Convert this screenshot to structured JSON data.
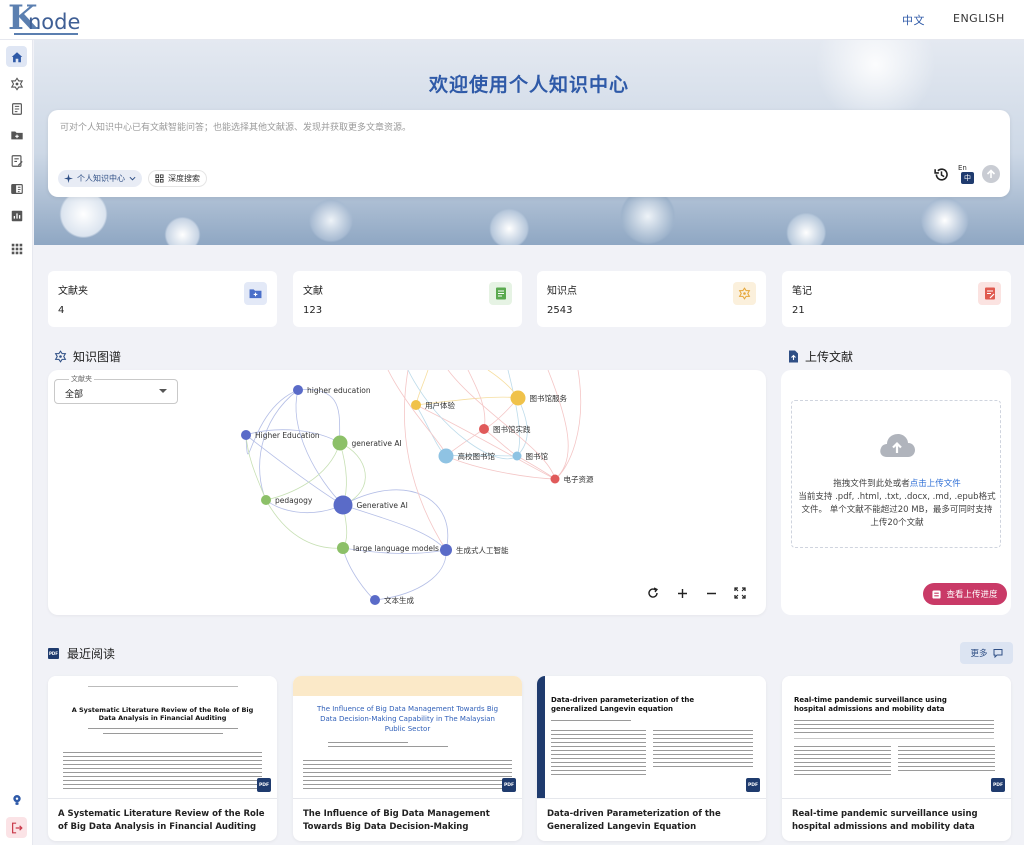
{
  "app": {
    "logo_k": "K",
    "logo_rest": "node"
  },
  "topbar": {
    "lang_zh": "中文",
    "lang_en": "ENGLISH"
  },
  "sidebar": {
    "items": [
      "home-icon",
      "knowledge-graph-icon",
      "library-icon",
      "folder-add-icon",
      "notes-icon",
      "reading-icon",
      "stats-icon",
      "apps-icon"
    ],
    "bottom": [
      "help-icon",
      "logout-icon"
    ]
  },
  "hero": {
    "title": "欢迎使用个人知识中心",
    "search_placeholder": "可对个人知识中心已有文献智能问答；也能选择其他文献源、发现并获取更多文章资源。",
    "chip_source": "个人知识中心",
    "chip_deep": "深度搜索",
    "lang_en": "En",
    "lang_zh": "中"
  },
  "stats": [
    {
      "label": "文献夹",
      "value": "4",
      "icon": "folder-icon",
      "color": "#4a6fc9"
    },
    {
      "label": "文献",
      "value": "123",
      "icon": "document-icon",
      "color": "#5aaa4f"
    },
    {
      "label": "知识点",
      "value": "2543",
      "icon": "knowledge-point-icon",
      "color": "#e6a73a"
    },
    {
      "label": "笔记",
      "value": "21",
      "icon": "note-icon",
      "color": "#e05a4f"
    }
  ],
  "knowledge_graph": {
    "title": "知识图谱",
    "folder_label": "文献夹",
    "folder_value": "全部",
    "nodes": [
      {
        "label": "higher education",
        "color": "#5a6bc8"
      },
      {
        "label": "Higher Education",
        "color": "#5a6bc8"
      },
      {
        "label": "generative AI",
        "color": "#8cc068"
      },
      {
        "label": "pedagogy",
        "color": "#8cc068"
      },
      {
        "label": "Generative AI",
        "color": "#5a6bc8"
      },
      {
        "label": "large language models",
        "color": "#8cc068"
      },
      {
        "label": "生成式人工智能",
        "color": "#5a6bc8"
      },
      {
        "label": "文本生成",
        "color": "#5a6bc8"
      },
      {
        "label": "用户体验",
        "color": "#f0c24a"
      },
      {
        "label": "图书馆服务",
        "color": "#f0c24a"
      },
      {
        "label": "图书馆实践",
        "color": "#e05a5a"
      },
      {
        "label": "高校图书馆",
        "color": "#8fc3e3"
      },
      {
        "label": "图书馆",
        "color": "#8fc3e3"
      },
      {
        "label": "电子资源",
        "color": "#e05a5a"
      }
    ],
    "tools": [
      "refresh-icon",
      "zoom-in-icon",
      "zoom-out-icon",
      "fullscreen-icon"
    ]
  },
  "upload": {
    "title": "上传文献",
    "drop_text": "拖拽文件到此处或者",
    "drop_link": "点击上传文件",
    "drop_hint": "当前支持 .pdf, .html, .txt, .docx, .md, .epub格式文件。 单个文献不能超过20 MB，最多可同时支持上传20个文献",
    "progress_button": "查看上传进度"
  },
  "recent": {
    "title": "最近阅读",
    "more": "更多",
    "cards": [
      {
        "title": "A Systematic Literature Review of the Role of Big Data Analysis in Financial Auditing",
        "thumb_head": "A Systematic Literature Review of the Role of Big Data Analysis in Financial Auditing",
        "badge": "PDF"
      },
      {
        "title": "The Influence of Big Data Management Towards Big Data Decision-Making Capabilit...",
        "thumb_head": "The Influence of Big Data Management Towards Big Data Decision-Making Capability in The Malaysian Public Sector",
        "badge": "PDF"
      },
      {
        "title": "Data-driven Parameterization of the Generalized Langevin Equation",
        "thumb_head": "Data-driven parameterization of the generalized Langevin equation",
        "badge": "PDF"
      },
      {
        "title": "Real-time pandemic surveillance using hospital admissions and mobility data",
        "thumb_head": "Real-time pandemic surveillance using hospital admissions and mobility data",
        "badge": "PDF"
      }
    ]
  }
}
